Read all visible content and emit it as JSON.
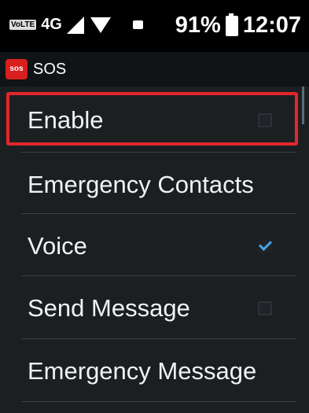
{
  "status_bar": {
    "volte_label": "VoLTE",
    "network_type": "4G",
    "battery": "91%",
    "time": "12:07",
    "icons": [
      "signal-icon",
      "wifi-icon",
      "message-icon",
      "battery-icon"
    ]
  },
  "app": {
    "title": "SOS",
    "logo_text": "sos"
  },
  "settings": {
    "items": [
      {
        "label": "Enable",
        "checkbox": true,
        "checked": false,
        "highlighted": true
      },
      {
        "label": "Emergency Contacts",
        "checkbox": false
      },
      {
        "label": "Voice",
        "checkbox": true,
        "checked": true
      },
      {
        "label": "Send Message",
        "checkbox": true,
        "checked": false
      },
      {
        "label": "Emergency Message",
        "checkbox": false
      }
    ]
  },
  "colors": {
    "highlight_border": "#e4262c",
    "checkmark": "#4aa3e8",
    "logo_background": "#d81e1e"
  }
}
